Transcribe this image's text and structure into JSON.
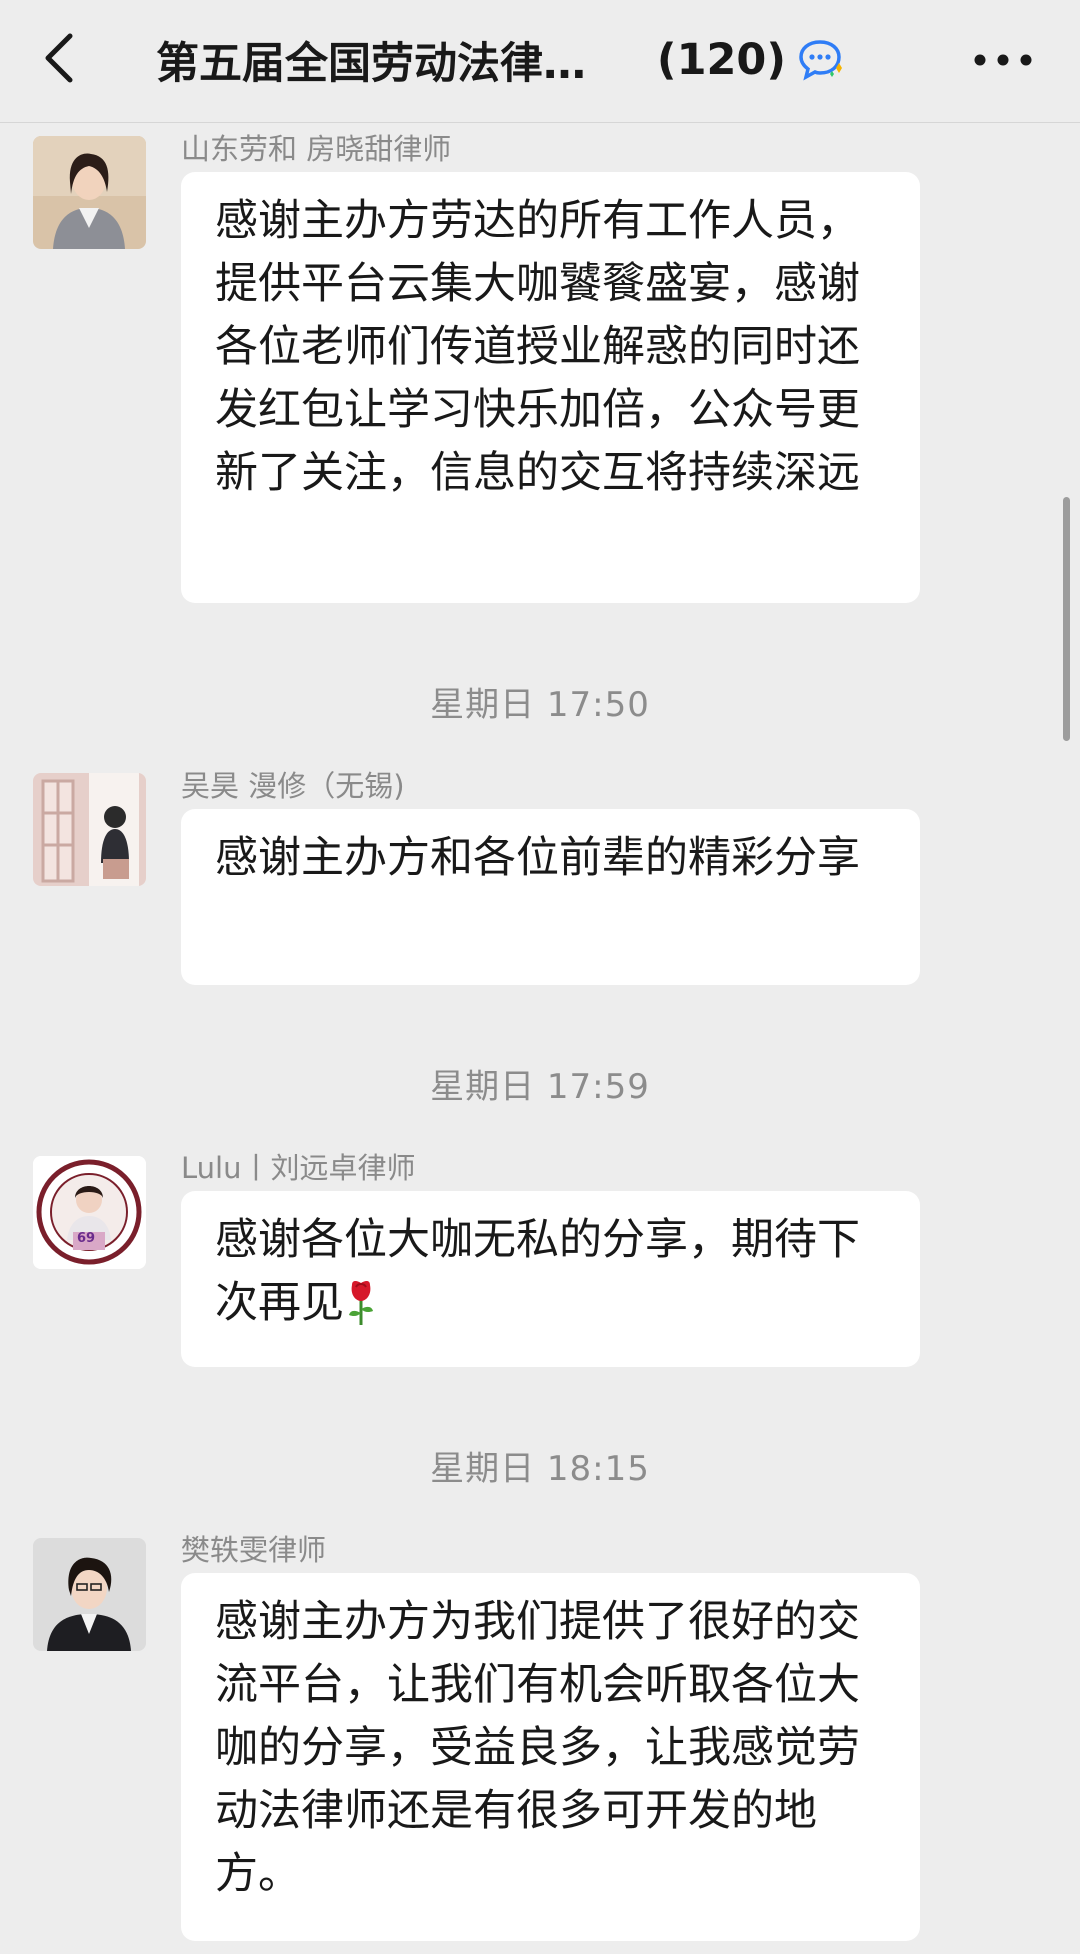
{
  "header": {
    "title": "第五届全国劳动法律师…",
    "count": "(120)",
    "back_icon": "chevron-left-icon",
    "more_icon": "more-dots-icon",
    "chat_icon": "group-chat-icon"
  },
  "messages": [
    {
      "sender": "山东劳和 房晓甜律师",
      "text": "感谢主办方劳达的所有工作人员，提供平台云集大咖饕餮盛宴，感谢各位老师们传道授业解惑的同时还发红包让学习快乐加倍，公众号更新了关注，信息的交互将持续深远"
    },
    {
      "time": "星期日 17:50",
      "sender": "吴昊 漫修（无锡)",
      "text": "感谢主办方和各位前辈的精彩分享"
    },
    {
      "time": "星期日 17:59",
      "sender": "Lulu丨刘远卓律师",
      "text": "感谢各位大咖无私的分享，期待下次再见",
      "avatar_badge": "69"
    },
    {
      "time": "星期日 18:15",
      "sender": "樊轶雯律师",
      "text": "感谢主办方为我们提供了很好的交流平台，让我们有机会听取各位大咖的分享，受益良多，让我感觉劳动法律师还是有很多可开发的地方。"
    }
  ]
}
